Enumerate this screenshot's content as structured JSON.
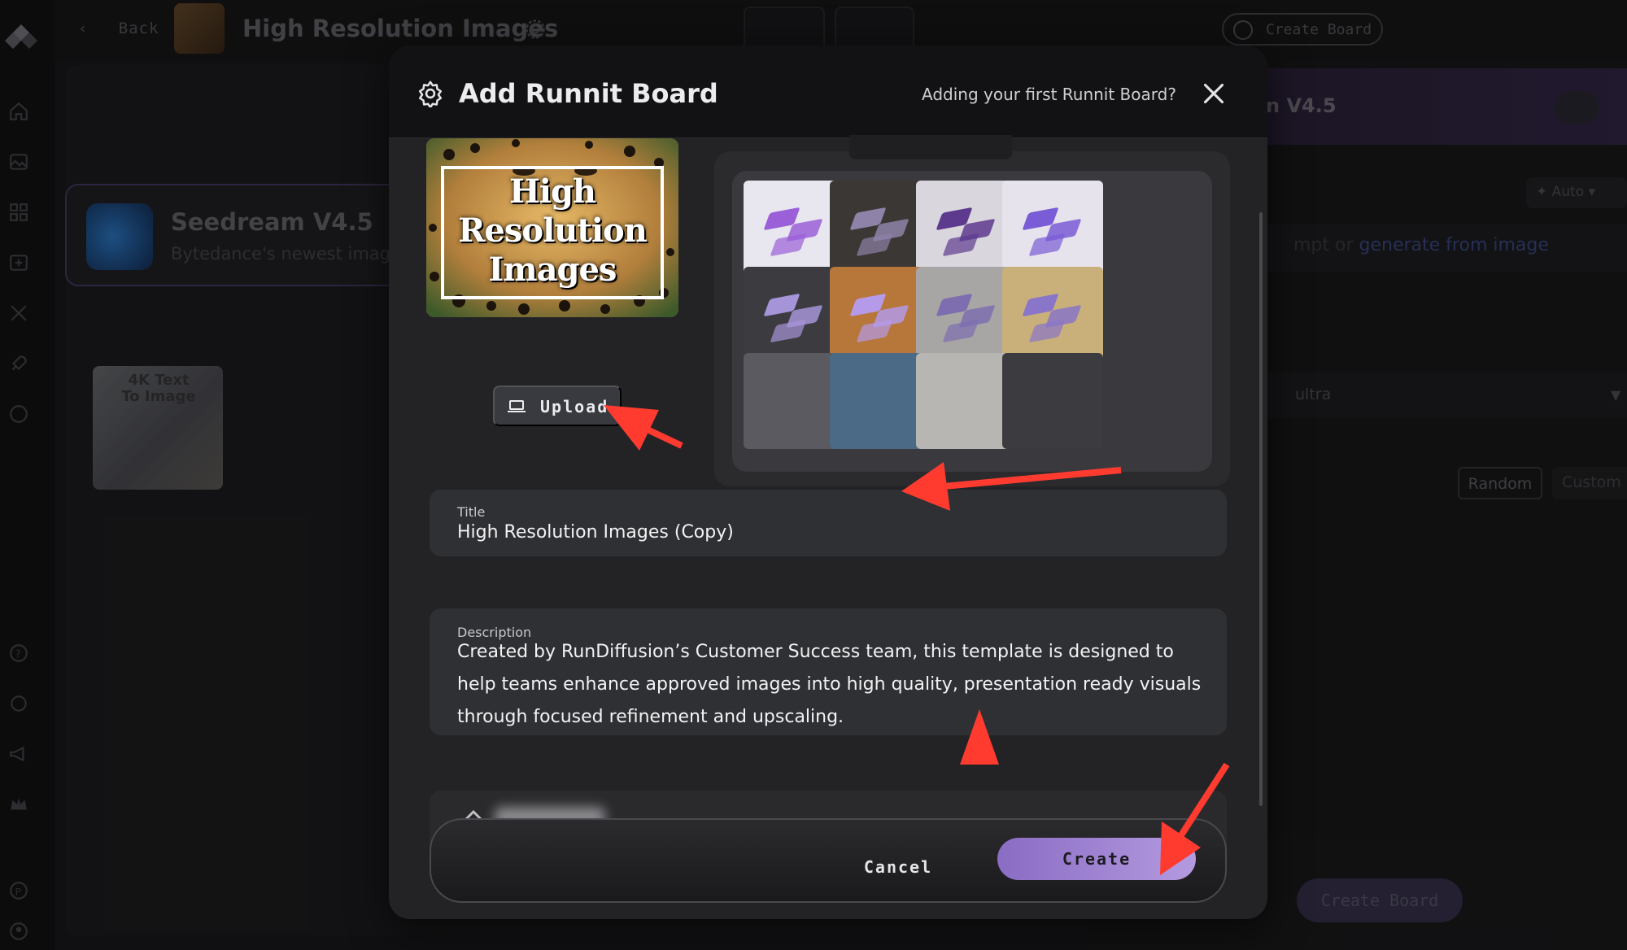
{
  "topbar": {
    "back_label": "Back",
    "board_title": "High Resolution Images",
    "create_board_label": "Create Board"
  },
  "sidebar": {
    "icons": [
      "home-icon",
      "gallery-icon",
      "apps-icon",
      "image-add-icon",
      "tools-icon",
      "rocket-icon",
      "github-icon",
      "help-icon",
      "badge-icon",
      "megaphone-icon",
      "crown-icon",
      "profile-icon",
      "account-icon"
    ]
  },
  "background": {
    "model_card": {
      "title": "Seedream V4.5",
      "subtitle": "Bytedance's newest imag"
    },
    "tile_label": "4K Text\nTo Image",
    "right_header_title": "n V4.5",
    "auto_label": "Auto",
    "prompt_prefix": "mpt or ",
    "prompt_link": "generate from image",
    "select_value": "ultra",
    "random_label": "Random",
    "custom_label": "Custom",
    "create_board_bottom": "Create Board"
  },
  "modal": {
    "title": "Add Runnit Board",
    "help_text": "Adding your first Runnit Board?",
    "cover_text": "High Resolution Images",
    "upload_label": "Upload",
    "title_field": {
      "label": "Title",
      "value": "High Resolution Images (Copy)"
    },
    "description_field": {
      "label": "Description",
      "value": "Created by RunDiffusion’s Customer Success team, this template is designed to help teams enhance approved images into high quality, presentation ready visuals through focused refinement and upscaling."
    },
    "cancel_label": "Cancel",
    "create_label": "Create",
    "gallery_thumbnails": [
      {
        "name": "purple-cubes-paper",
        "bg": "#e8e6ee",
        "accent": "#9b5fd8"
      },
      {
        "name": "dark-leather-logo",
        "bg": "#3a3734",
        "accent": "#8e82a8"
      },
      {
        "name": "ink-splash-logo",
        "bg": "#d9d6de",
        "accent": "#5e3a8e"
      },
      {
        "name": "blueprint-logo",
        "bg": "#e6e3ec",
        "accent": "#7a5cd6"
      },
      {
        "name": "dark-stone-logo",
        "bg": "#3c3c40",
        "accent": "#a694d8"
      },
      {
        "name": "wood-desk-logo",
        "bg": "#b7763a",
        "accent": "#b49ae8"
      },
      {
        "name": "metal-tiles-logo",
        "bg": "#a8a6a4",
        "accent": "#7e6eb0"
      },
      {
        "name": "vintage-map-logo",
        "bg": "#c9b07a",
        "accent": "#8a76c8"
      }
    ]
  }
}
